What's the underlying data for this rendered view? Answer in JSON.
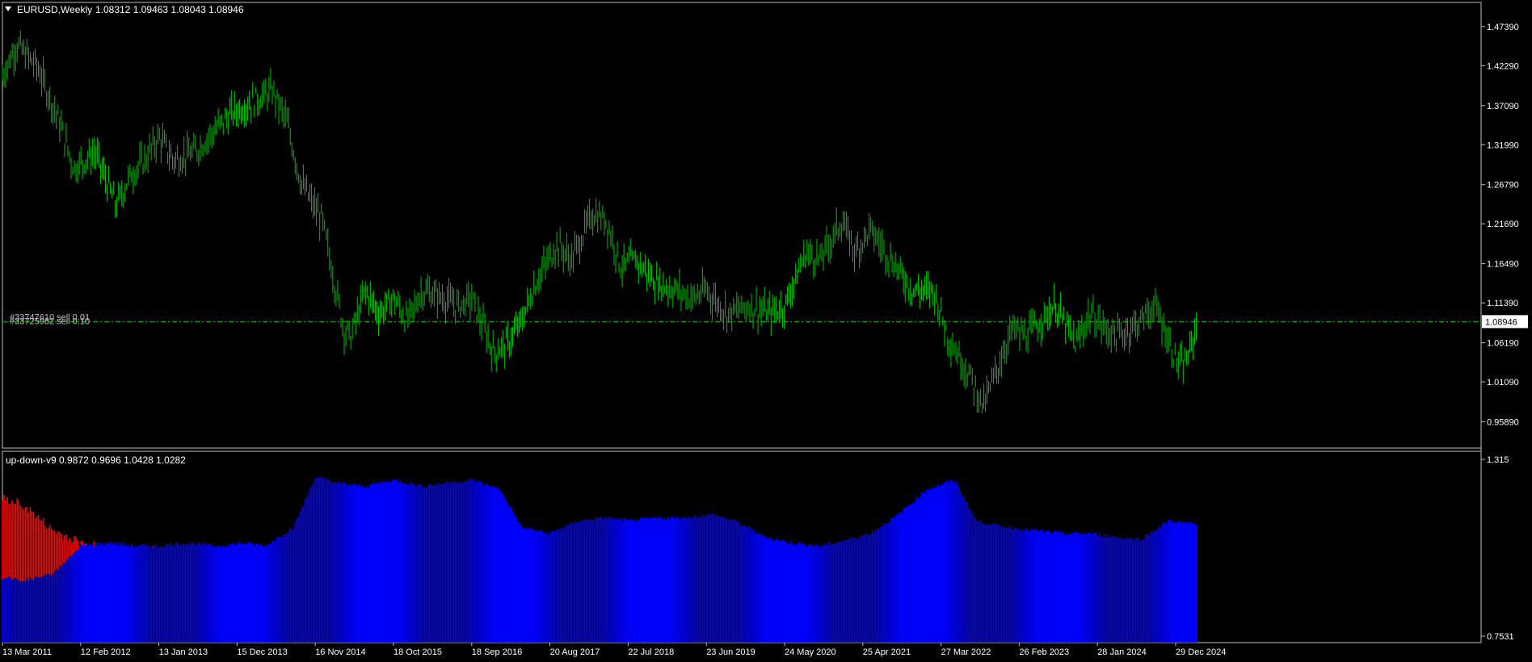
{
  "header": {
    "symbol_title": "EURUSD,Weekly",
    "ohlc": "1.08312 1.09463 1.08043 1.08946",
    "dropdown_icon": "triangle-down-icon"
  },
  "price_panel": {
    "current_price": "1.08946",
    "order_labels": [
      "#33747610 sell 0.01",
      "#33725982 sell 0.10"
    ],
    "colors": {
      "bars": "#00c000",
      "level_line": "#00c000",
      "axis": "#ffffff",
      "background": "#000000"
    }
  },
  "indicator_panel": {
    "title": "up-down-v9 0.9872 0.9696 1.0428 1.0282",
    "scale_max": "1.315",
    "scale_min": "0.7531",
    "colors": {
      "up": "#0000ff",
      "down": "#ff0000"
    }
  },
  "chart_data": [
    {
      "type": "bar",
      "name": "EURUSD Weekly price",
      "ylim": [
        0.93,
        1.5
      ],
      "y_ticks": [
        "1.47390",
        "1.42290",
        "1.37090",
        "1.31990",
        "1.26790",
        "1.21690",
        "1.16490",
        "1.11390",
        "1.06190",
        "1.01090",
        "0.95890"
      ],
      "x_ticks": [
        "13 Mar 2011",
        "12 Feb 2012",
        "13 Jan 2013",
        "15 Dec 2013",
        "16 Nov 2014",
        "18 Oct 2015",
        "18 Sep 2016",
        "20 Aug 2017",
        "22 Jul 2018",
        "23 Jun 2019",
        "24 May 2020",
        "25 Apr 2021",
        "27 Mar 2022",
        "26 Feb 2023",
        "28 Jan 2024",
        "29 Dec 2024"
      ],
      "close_path_x": [
        "Mar 2011",
        "May 2011",
        "Aug 2011",
        "Nov 2011",
        "Jan 2012",
        "Apr 2012",
        "Jul 2012",
        "Sep 2012",
        "Nov 2012",
        "Jan 2013",
        "Mar 2013",
        "Jun 2013",
        "Sep 2013",
        "Nov 2013",
        "Jan 2014",
        "May 2014",
        "Jul 2014",
        "Sep 2014",
        "Dec 2014",
        "Mar 2015",
        "Apr 2015",
        "Jun 2015",
        "Aug 2015",
        "Oct 2015",
        "Dec 2015",
        "Feb 2016",
        "May 2016",
        "Jul 2016",
        "Sep 2016",
        "Dec 2016",
        "Feb 2017",
        "Apr 2017",
        "Jun 2017",
        "Sep 2017",
        "Nov 2017",
        "Feb 2018",
        "Apr 2018",
        "Jun 2018",
        "Aug 2018",
        "Nov 2018",
        "Feb 2019",
        "Apr 2019",
        "Jun 2019",
        "Sep 2019",
        "Dec 2019",
        "Mar 2020",
        "May 2020",
        "Aug 2020",
        "Oct 2020",
        "Jan 2021",
        "Mar 2021",
        "May 2021",
        "Aug 2021",
        "Nov 2021",
        "Feb 2022",
        "Apr 2022",
        "Jul 2022",
        "Sep 2022",
        "Nov 2022",
        "Jan 2023",
        "Mar 2023",
        "May 2023",
        "Jul 2023",
        "Oct 2023",
        "Dec 2023",
        "Feb 2024",
        "Apr 2024",
        "Jul 2024",
        "Sep 2024",
        "Oct 2024",
        "Dec 2024",
        "Jan 2025",
        "Feb 2025",
        "Mar 2025"
      ],
      "close_path_y": [
        1.41,
        1.45,
        1.42,
        1.35,
        1.29,
        1.31,
        1.24,
        1.28,
        1.3,
        1.33,
        1.3,
        1.31,
        1.34,
        1.36,
        1.37,
        1.39,
        1.35,
        1.27,
        1.22,
        1.08,
        1.07,
        1.13,
        1.1,
        1.12,
        1.09,
        1.13,
        1.12,
        1.11,
        1.12,
        1.05,
        1.06,
        1.09,
        1.14,
        1.19,
        1.17,
        1.23,
        1.22,
        1.16,
        1.17,
        1.14,
        1.13,
        1.12,
        1.13,
        1.1,
        1.11,
        1.1,
        1.11,
        1.18,
        1.17,
        1.22,
        1.18,
        1.21,
        1.17,
        1.13,
        1.13,
        1.07,
        1.02,
        0.98,
        1.03,
        1.08,
        1.07,
        1.09,
        1.11,
        1.06,
        1.1,
        1.08,
        1.07,
        1.09,
        1.11,
        1.09,
        1.04,
        1.03,
        1.05,
        1.09
      ],
      "last_close": 1.08946
    },
    {
      "type": "area",
      "name": "up-down-v9",
      "ylim": [
        0.7531,
        1.315
      ],
      "x": [
        "Mar 2011",
        "Jun 2011",
        "Oct 2011",
        "Feb 2012",
        "Jun 2012",
        "Oct 2012",
        "Jan 2013",
        "May 2013",
        "Sep 2013",
        "Jan 2014",
        "Apr 2014",
        "Aug 2014",
        "Nov 2014",
        "Feb 2015",
        "Jun 2015",
        "Oct 2015",
        "Feb 2016",
        "May 2016",
        "Sep 2016",
        "Jan 2017",
        "Apr 2017",
        "Aug 2017",
        "Dec 2017",
        "Apr 2018",
        "Jul 2018",
        "Nov 2018",
        "Mar 2019",
        "Jul 2019",
        "Oct 2019",
        "Feb 2020",
        "Jun 2020",
        "Oct 2020",
        "Feb 2021",
        "May 2021",
        "Sep 2021",
        "Jan 2022",
        "May 2022",
        "Aug 2022",
        "Dec 2022",
        "Apr 2023",
        "Aug 2023",
        "Dec 2023",
        "Mar 2024",
        "Jul 2024",
        "Nov 2024",
        "Mar 2025"
      ],
      "series": [
        {
          "values": [
            0.94,
            0.93,
            0.95,
            1.04,
            1.05,
            1.04,
            1.04,
            1.05,
            1.04,
            1.05,
            1.04,
            1.1,
            1.26,
            1.24,
            1.23,
            1.25,
            1.23,
            1.24,
            1.25,
            1.22,
            1.1,
            1.08,
            1.12,
            1.13,
            1.12,
            1.13,
            1.13,
            1.14,
            1.12,
            1.07,
            1.05,
            1.04,
            1.06,
            1.08,
            1.14,
            1.22,
            1.25,
            1.12,
            1.1,
            1.09,
            1.08,
            1.08,
            1.07,
            1.06,
            1.12,
            1.11
          ]
        },
        {
          "values": [
            1.19,
            1.17,
            1.09,
            1.05,
            1.04,
            1.04,
            1.04,
            1.04,
            1.04,
            1.04,
            1.04,
            1.04,
            1.04,
            1.04,
            1.04,
            1.04,
            1.04,
            1.04,
            1.04,
            1.04,
            1.04,
            1.04,
            1.04,
            1.04,
            1.04,
            1.04,
            1.04,
            1.04,
            1.04,
            1.04,
            1.04,
            1.04,
            1.04,
            1.04,
            1.04,
            1.04,
            1.04,
            1.04,
            1.04,
            1.04,
            1.04,
            1.04,
            1.04,
            1.04,
            1.04,
            1.04
          ]
        }
      ]
    }
  ]
}
